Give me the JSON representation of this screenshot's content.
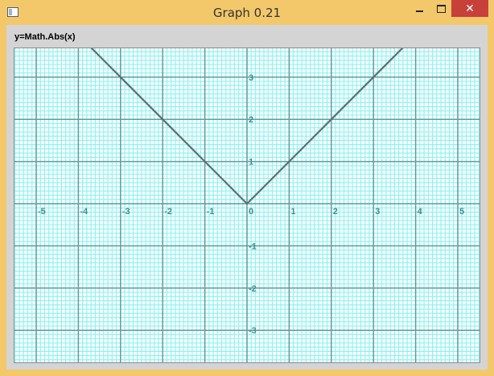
{
  "window": {
    "title": "Graph 0.21",
    "icon": "app-window-icon",
    "controls": {
      "minimize": "minimize-icon",
      "maximize": "maximize-icon",
      "close": "close-icon"
    }
  },
  "graph": {
    "formula_label": "y=Math.Abs(x)"
  },
  "colors": {
    "frame": "#f3c86b",
    "client": "#d4d4d4",
    "minor_grid": "#8ff2f2",
    "major_grid": "#5b9e9e",
    "axis_labels": "#3f8f8f",
    "curve": "#5f6f6f",
    "close_button": "#c8403a"
  },
  "chart_data": {
    "type": "line",
    "title": "",
    "xlabel": "",
    "ylabel": "",
    "xlim": [
      -5.5,
      5.5
    ],
    "ylim": [
      -3.7,
      3.7
    ],
    "grid": true,
    "x_ticks": [
      "-5",
      "-4",
      "-3",
      "-2",
      "-1",
      "0",
      "1",
      "2",
      "3",
      "4",
      "5"
    ],
    "y_ticks": [
      "3",
      "2",
      "1",
      "-1",
      "-2",
      "-3"
    ],
    "series": [
      {
        "x": [
          -3.7,
          -3,
          -2,
          -1,
          0,
          1,
          2,
          3,
          3.7
        ],
        "y": [
          3.7,
          3,
          2,
          1,
          0,
          1,
          2,
          3,
          3.7
        ]
      }
    ]
  }
}
